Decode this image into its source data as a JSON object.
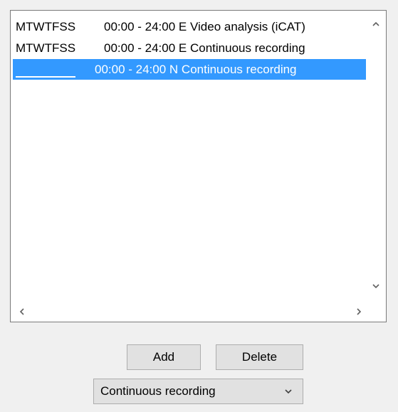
{
  "schedule_list": {
    "items": [
      {
        "days": "MTWTFSS",
        "schedule": "00:00 - 24:00 E Video analysis (iCAT)"
      },
      {
        "days": "MTWTFSS",
        "schedule": "00:00 - 24:00 E Continuous recording"
      },
      {
        "days": "",
        "schedule": "00:00 - 24:00 N Continuous recording"
      }
    ],
    "scroll_up": "^",
    "scroll_down": "⌄",
    "scroll_left": "<",
    "scroll_right": ">"
  },
  "buttons": {
    "add_label": "Add",
    "delete_label": "Delete"
  },
  "mode_select": {
    "value": "Continuous recording",
    "chevron": "⌄"
  },
  "colors": {
    "selection": "#3399ff",
    "window_bg": "#f0f0f0"
  }
}
